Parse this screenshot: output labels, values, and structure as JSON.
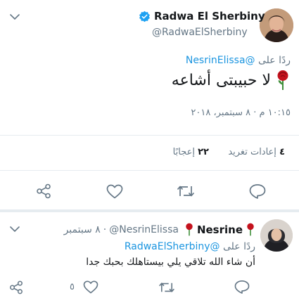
{
  "colors": {
    "accent": "#1b95e0",
    "muted": "#657786",
    "text": "#14171a",
    "divider": "#e6ecf0",
    "verified": "#1da1f2",
    "heart_red": "#c4121d"
  },
  "tweet": {
    "author_name": "Radwa El Sherbiny",
    "author_handle": "@RadwaElSherbiny",
    "verified": true,
    "reply_prefix": "ردًا على",
    "reply_to": "@NesrinElissa",
    "text": "لا حبيبتى أشاعه",
    "emoji": "rose-icon",
    "timestamp": "١٠:١٥ م · ٨ سبتمبر، ٢٠١٨",
    "retweets_count": "٤",
    "retweets_label": "إعادات تغريد",
    "likes_count": "٢٢",
    "likes_label": "إعجابًا"
  },
  "reply": {
    "author_name": "Nesrine",
    "author_handle": "@NesrinElissa",
    "date": "٨ سبتمبر",
    "separator": "·",
    "reply_prefix": "ردًا على",
    "reply_to": "@RadwaElSherbiny",
    "text": "أن شاء الله تلاقي يلي بيستاهلك بحبك جدا",
    "likes_count": "٥"
  }
}
